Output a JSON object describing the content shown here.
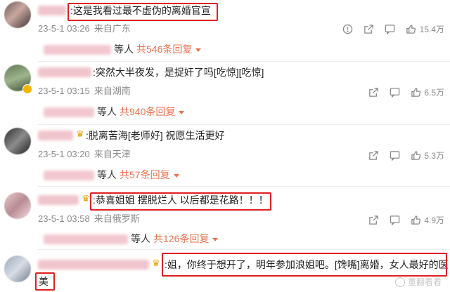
{
  "comments": [
    {
      "text": ":这是我看过最不虚伪的离婚官宣",
      "date": "23-5-1 03:26",
      "location": "来自广东",
      "likes": "15.4万",
      "reply_people": "等人",
      "reply_count": "共546条回复",
      "highlighted": true,
      "has_more_icon": true
    },
    {
      "text": ":突然大半夜发，是捉奸了吗[吃惊][吃惊]",
      "date": "23-5-1 03:15",
      "location": "来自湖南",
      "likes": "6.5万",
      "reply_people": "等人",
      "reply_count": "共940条回复",
      "highlighted": false,
      "verified": true
    },
    {
      "text": ":脱离苦海[老师好] 祝愿生活更好",
      "date": "23-5-1 03:20",
      "location": "来自天津",
      "likes": "5.3万",
      "reply_people": "等人",
      "reply_count": "共57条回复",
      "highlighted": false,
      "crown": true
    },
    {
      "text": ":恭喜姐姐 摆脱烂人 以后都是花路！！！",
      "date": "23-5-1 03:58",
      "location": "来自俄罗斯",
      "likes": "4.9万",
      "reply_people": "等人",
      "reply_count": "共126条回复",
      "highlighted": true,
      "crown": true
    },
    {
      "text": ":姐，你终于想开了，明年参加浪姐吧。[馋嘴]离婚，女人最好的医",
      "text_cont": "美",
      "highlighted": true,
      "crown": true
    }
  ],
  "watermark": "重翻看看",
  "colors": {
    "highlight": "#e02020",
    "reply_link": "#eb7350",
    "meta": "#8a8a8a"
  },
  "icons": [
    "more-icon",
    "share-icon",
    "comment-icon",
    "like-icon",
    "crown-icon",
    "verified-badge-icon"
  ]
}
